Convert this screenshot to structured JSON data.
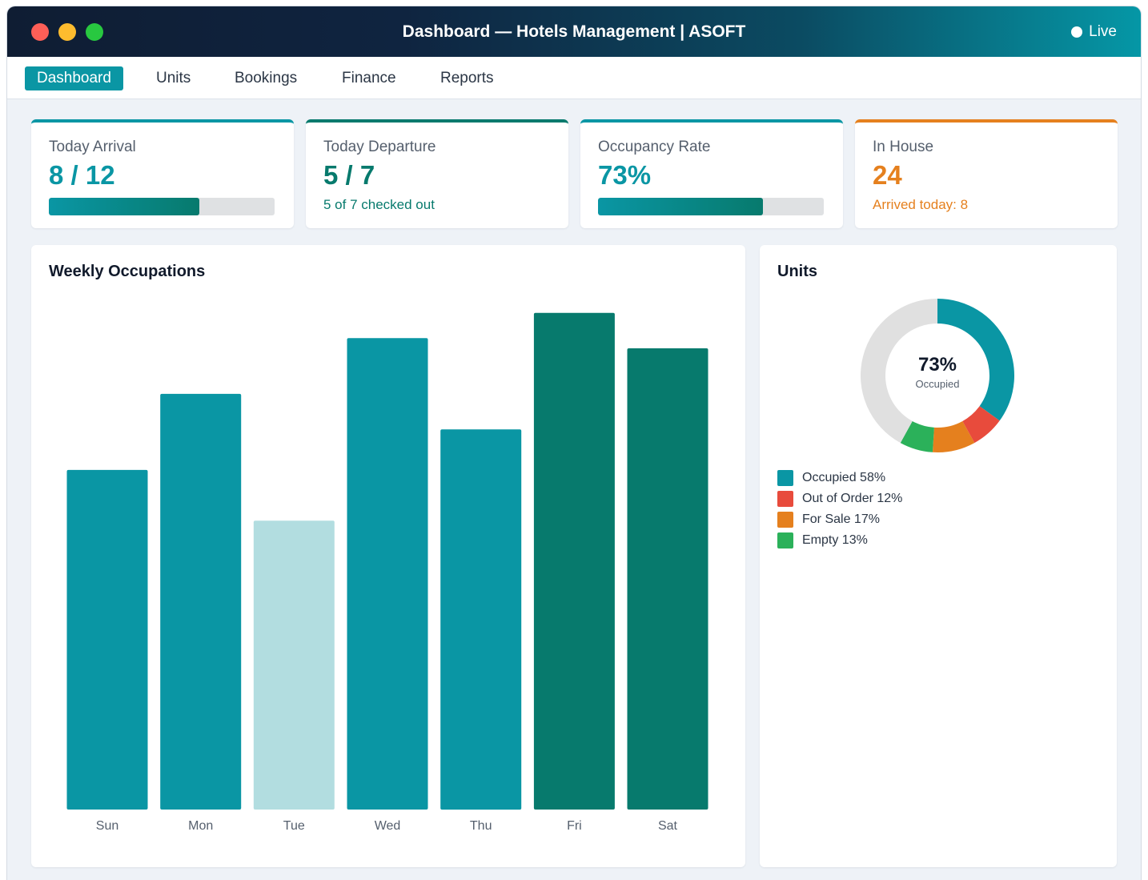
{
  "window": {
    "title": "Dashboard — Hotels Management | ASOFT",
    "status": "Live"
  },
  "nav": {
    "tabs": [
      "Dashboard",
      "Units",
      "Bookings",
      "Finance",
      "Reports"
    ],
    "active": "Dashboard"
  },
  "kpis": {
    "arrival": {
      "label": "Today Arrival",
      "value": "8 / 12",
      "progress": 0.667,
      "color": "#0a96a4"
    },
    "departure": {
      "label": "Today Departure",
      "value": "5 / 7",
      "sub": "5 of 7 checked out",
      "color": "#077a6d"
    },
    "occupancy": {
      "label": "Occupancy Rate",
      "value": "73%",
      "progress": 0.73,
      "color": "#0a96a4"
    },
    "inhouse": {
      "label": "In House",
      "value": "24",
      "sub": "Arrived today: 8",
      "color": "#e5801e"
    }
  },
  "weekly": {
    "title": "Weekly Occupations",
    "chart_data": {
      "type": "bar",
      "categories": [
        "Sun",
        "Mon",
        "Tue",
        "Wed",
        "Thu",
        "Fri",
        "Sat"
      ],
      "values": [
        67,
        82,
        57,
        93,
        75,
        98,
        91
      ],
      "ylim": [
        0,
        100
      ],
      "colors": [
        "#0a96a4",
        "#0a96a4",
        "#b2dde0",
        "#0a96a4",
        "#0a96a4",
        "#077a6d",
        "#077a6d"
      ]
    }
  },
  "units": {
    "title": "Units",
    "center_value": "73%",
    "center_label": "Occupied",
    "chart_data": {
      "type": "pie",
      "donut": true,
      "slices": [
        {
          "label": "Occupied",
          "value": 35,
          "color": "#0a96a4"
        },
        {
          "label": "Out of Order",
          "value": 7,
          "color": "#e84b3c"
        },
        {
          "label": "For Sale",
          "value": 9,
          "color": "#e5801e"
        },
        {
          "label": "Empty",
          "value": 7,
          "color": "#2bb15a"
        },
        {
          "label": "Remaining",
          "value": 42,
          "color": "#e0e0e0"
        }
      ]
    },
    "legend": [
      {
        "text": "Occupied 58%",
        "color": "#0a96a4"
      },
      {
        "text": "Out of Order 12%",
        "color": "#e84b3c"
      },
      {
        "text": "For Sale 17%",
        "color": "#e5801e"
      },
      {
        "text": "Empty 13%",
        "color": "#2bb15a"
      }
    ]
  }
}
